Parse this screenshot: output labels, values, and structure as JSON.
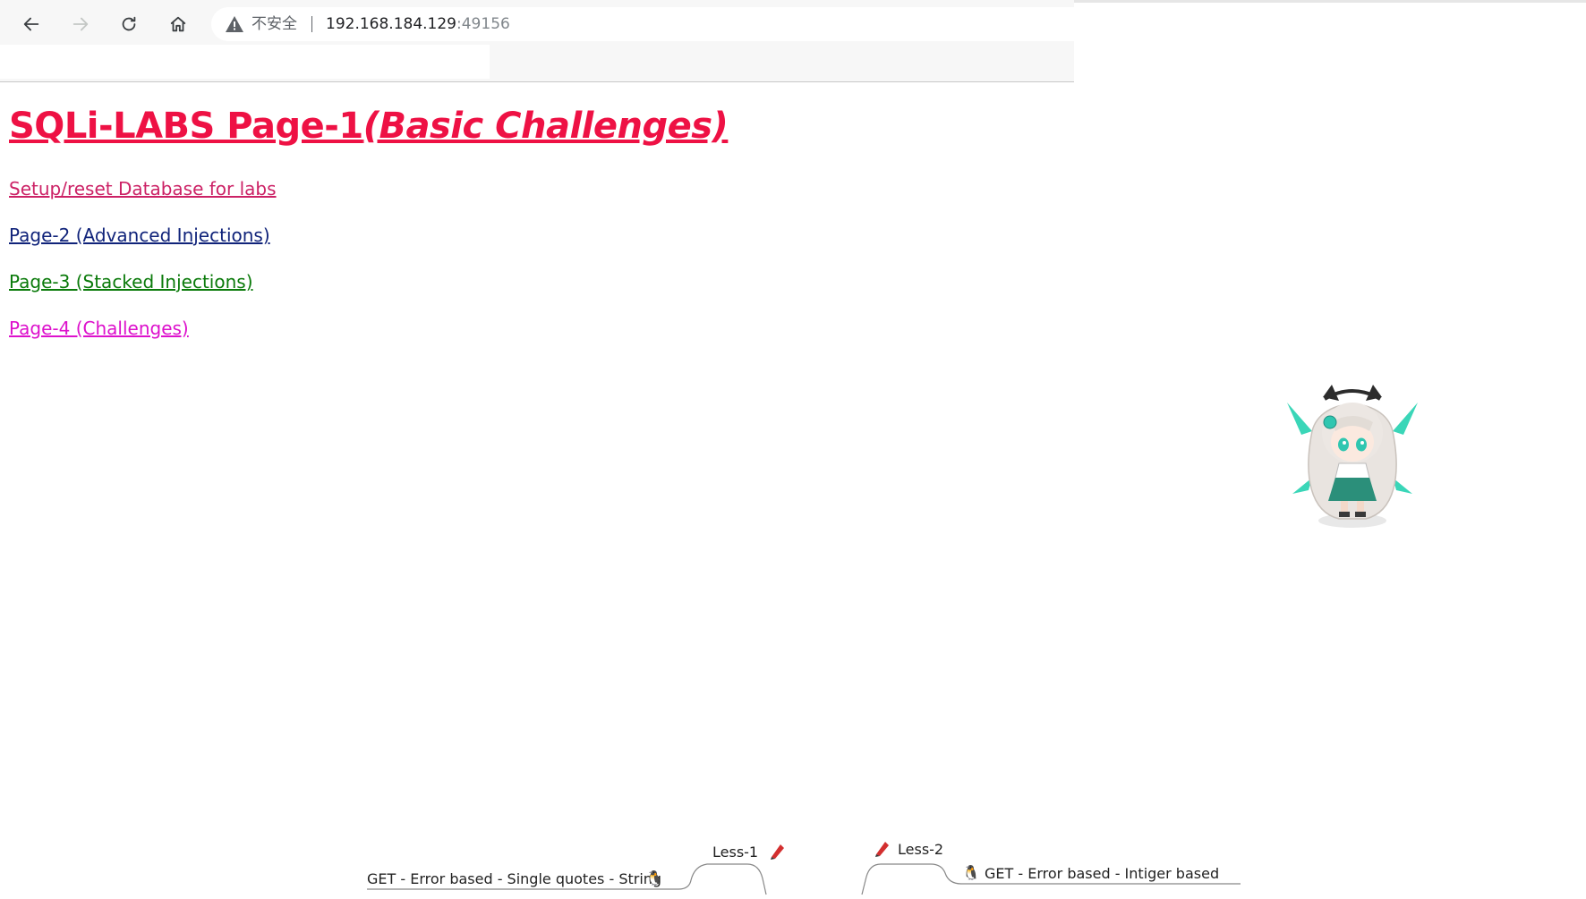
{
  "browser": {
    "security_label": "不安全",
    "url_host": "192.168.184.129",
    "url_port": ":49156"
  },
  "page": {
    "title_main": "SQLi-LABS Page-1",
    "title_sub": "(Basic Challenges)",
    "links": {
      "setup": "Setup/reset Database for labs",
      "page2": "Page-2 (Advanced Injections)",
      "page3": "Page-3 (Stacked Injections)",
      "page4": "Page-4 (Challenges)"
    }
  },
  "mindmap": {
    "node1_label": "Less-1",
    "node1_desc": "GET - Error based - Single quotes - String",
    "node2_label": "Less-2",
    "node2_desc": "GET - Error based - Intiger based"
  },
  "colors": {
    "title": "#ee1144",
    "setup_link": "#cc2266",
    "page2_link": "#10237a",
    "page3_link": "#0a7a0a",
    "page4_link": "#dd11cc"
  }
}
